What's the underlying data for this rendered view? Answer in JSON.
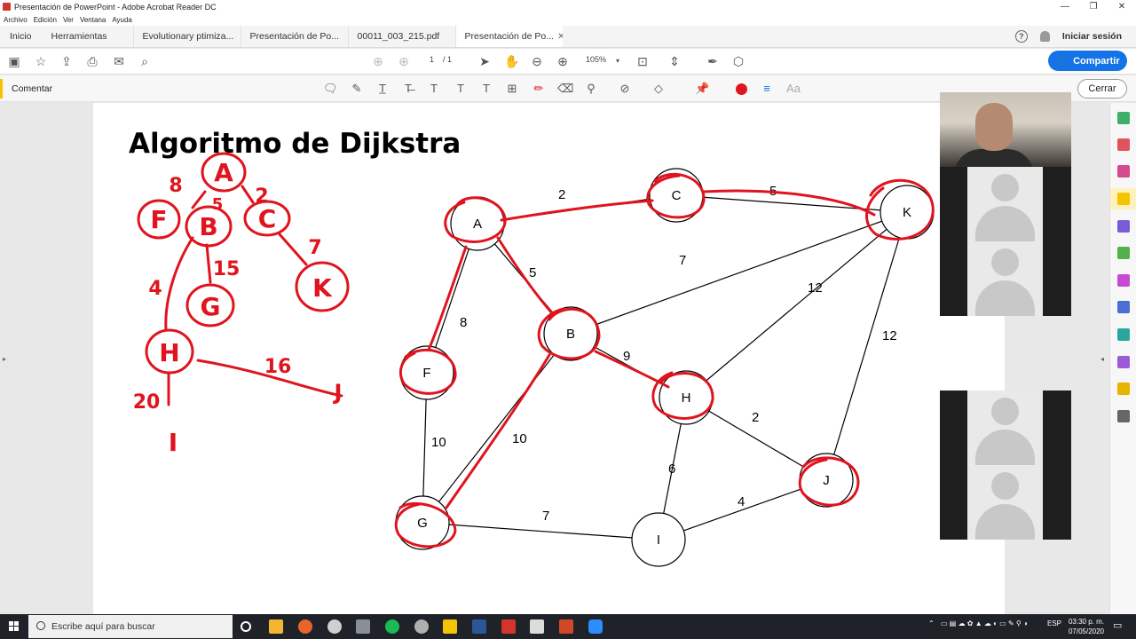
{
  "window": {
    "title": "Presentación de PowerPoint - Adobe Acrobat Reader DC",
    "controls": [
      "—",
      "❐",
      "✕"
    ]
  },
  "menu": [
    "Archivo",
    "Edición",
    "Ver",
    "Ventana",
    "Ayuda"
  ],
  "tabs": {
    "nav": [
      "Inicio",
      "Herramientas"
    ],
    "documents": [
      {
        "label": "Evolutionary ptimiza...",
        "active": false
      },
      {
        "label": "Presentación de Po...",
        "active": false
      },
      {
        "label": "00011_003_215.pdf",
        "active": false
      },
      {
        "label": "Presentación de Po...",
        "active": true
      }
    ],
    "help_icon": "?",
    "sign_in": "Iniciar sesión"
  },
  "toolbar": {
    "page_current": "1",
    "page_total": "/ 1",
    "zoom": "105%",
    "share_label": "Compartir"
  },
  "comment_bar": {
    "label": "Comentar",
    "close_label": "Cerrar",
    "accent_color": "#f5c400",
    "ink_color": "#e0141e"
  },
  "slide": {
    "title": "Algoritmo de Dijkstra",
    "graph": {
      "nodes": [
        {
          "id": "A",
          "label": "A"
        },
        {
          "id": "C",
          "label": "C"
        },
        {
          "id": "K",
          "label": "K"
        },
        {
          "id": "B",
          "label": "B"
        },
        {
          "id": "F",
          "label": "F"
        },
        {
          "id": "H",
          "label": "H"
        },
        {
          "id": "J",
          "label": "J"
        },
        {
          "id": "G",
          "label": "G"
        },
        {
          "id": "I",
          "label": "I"
        }
      ],
      "edges": [
        {
          "from": "A",
          "to": "C",
          "weight": "2"
        },
        {
          "from": "C",
          "to": "K",
          "weight": "5"
        },
        {
          "from": "A",
          "to": "B",
          "weight": "5"
        },
        {
          "from": "B",
          "to": "K",
          "weight": "7"
        },
        {
          "from": "H",
          "to": "K",
          "weight": "12"
        },
        {
          "from": "J",
          "to": "K",
          "weight": "12"
        },
        {
          "from": "A",
          "to": "F",
          "weight": "8"
        },
        {
          "from": "B",
          "to": "H",
          "weight": "9"
        },
        {
          "from": "F",
          "to": "G",
          "weight": "10"
        },
        {
          "from": "B",
          "to": "G",
          "weight": "10"
        },
        {
          "from": "H",
          "to": "J",
          "weight": "2"
        },
        {
          "from": "H",
          "to": "I",
          "weight": "6"
        },
        {
          "from": "G",
          "to": "I",
          "weight": "7"
        },
        {
          "from": "I",
          "to": "J",
          "weight": "4"
        }
      ]
    },
    "handwritten_tree": {
      "nodes": [
        "A",
        "F",
        "B",
        "C",
        "K",
        "G",
        "H",
        "I",
        "J"
      ],
      "labels": [
        "8",
        "5",
        "2",
        "7",
        "4",
        "15",
        "16",
        "20"
      ]
    }
  },
  "taskbar": {
    "search_placeholder": "Escribe aquí para buscar",
    "language": "ESP",
    "time": "03:30 p. m.",
    "date": "07/05/2020"
  }
}
